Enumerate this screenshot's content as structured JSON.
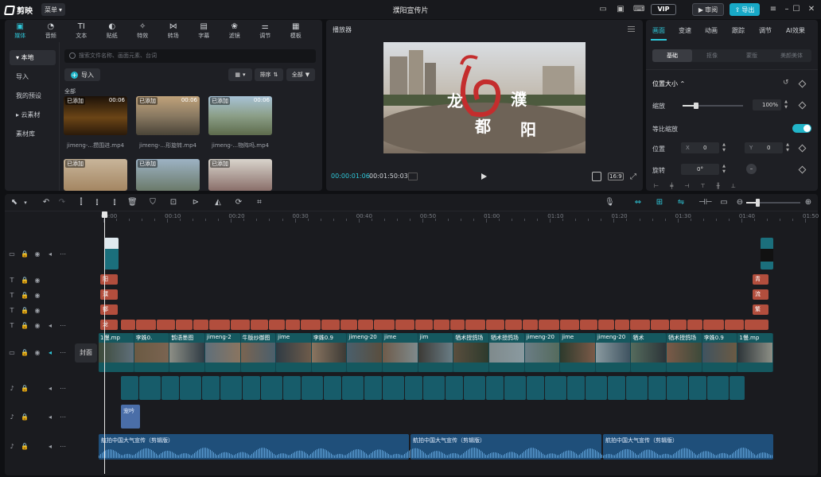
{
  "app": {
    "brand": "剪映",
    "menu_label": "菜单",
    "doc_title": "濮阳宣传片",
    "vip_label": "VIP",
    "review_label": "审阅",
    "export_label": "导出"
  },
  "media": {
    "tabs": [
      {
        "label": "媒体",
        "icon": "media-icon"
      },
      {
        "label": "音频",
        "icon": "audio-icon"
      },
      {
        "label": "文本",
        "icon": "text-icon"
      },
      {
        "label": "贴纸",
        "icon": "sticker-icon"
      },
      {
        "label": "特效",
        "icon": "effects-icon"
      },
      {
        "label": "转场",
        "icon": "transition-icon"
      },
      {
        "label": "字幕",
        "icon": "subtitle-icon"
      },
      {
        "label": "滤镜",
        "icon": "filter-icon"
      },
      {
        "label": "调节",
        "icon": "adjust-icon"
      },
      {
        "label": "模板",
        "icon": "template-icon"
      }
    ],
    "sidebar": [
      {
        "label": "▾ 本地",
        "active": true
      },
      {
        "label": "导入",
        "active": false
      },
      {
        "label": "我的预设",
        "active": false
      },
      {
        "label": "▸ 云素材",
        "active": false
      },
      {
        "label": "素材库",
        "active": false
      }
    ],
    "search_placeholder": "搜索文件名称、画面元素、台词",
    "import_label": "导入",
    "sort_label": "排序",
    "all_filter_label": "全部",
    "section_label": "全部",
    "thumbs": [
      {
        "added": "已添加",
        "dur": "00:06",
        "label": "jimeng-...攒围进.mp4"
      },
      {
        "added": "已添加",
        "dur": "00:06",
        "label": "jimeng-...形旋转.mp4"
      },
      {
        "added": "已添加",
        "dur": "00:06",
        "label": "jimeng-...物阵吗.mp4"
      },
      {
        "added": "已添加",
        "dur": "",
        "label": ""
      },
      {
        "added": "已添加",
        "dur": "",
        "label": ""
      },
      {
        "added": "已添加",
        "dur": "",
        "label": ""
      }
    ]
  },
  "player": {
    "title": "播放器",
    "time_current": "00:00:01:06",
    "time_total": "00:01:50:03",
    "ratio": "16:9",
    "overlay_text": [
      "龙",
      "都",
      "濮",
      "阳"
    ]
  },
  "props": {
    "tabs": [
      "画面",
      "变速",
      "动画",
      "跟踪",
      "调节",
      "AI效果"
    ],
    "sub_tabs": [
      "基础",
      "抠像",
      "蒙版",
      "美颜美体"
    ],
    "section_title": "位置大小",
    "scale_label": "缩放",
    "scale_value": "100%",
    "uniform_scale_label": "等比缩放",
    "position_label": "位置",
    "pos_x_label": "X",
    "pos_x_value": "0",
    "pos_y_label": "Y",
    "pos_y_value": "0",
    "rotate_label": "旋转",
    "rotate_value": "0°"
  },
  "timeline": {
    "ruler": [
      "00:00",
      "00:10",
      "00:20",
      "00:30",
      "00:40",
      "00:50",
      "01:00",
      "01:10",
      "01:20",
      "01:30",
      "01:40",
      "01:50"
    ],
    "cover_label": "封面",
    "text_clips_left": [
      "阳",
      "濮",
      "都",
      "龙"
    ],
    "text_clips_right": [
      "青",
      "流",
      "繁",
      "华"
    ],
    "video_clip_labels": [
      "1慢.mp",
      "李姝0.",
      "鹊语墨图",
      "jimeng-2",
      "牛版炒御图",
      "jime",
      "李姝0.9",
      "jimeng-20",
      "jime",
      "jim",
      "牺术授鸽场",
      "牺术授鸽场",
      "jimeng-20",
      "jime",
      "jimeng-20",
      "牺术",
      "牺术授鸽场",
      "李姝0.9",
      "1慢.mp"
    ],
    "vo_clip_label": "宠吟",
    "music_label": "航拍中国大气宣传（剪辑版）",
    "music_label_2": "航拍中国大气宣传（剪辑版）",
    "music_label_3": "航拍中国大气宣传（剪辑版）"
  },
  "colors": {
    "accent": "#2fc7d9",
    "text_clip": "#b24e3d",
    "video_clip": "#1b6f7c",
    "audio_clip": "#1f4f7a"
  }
}
